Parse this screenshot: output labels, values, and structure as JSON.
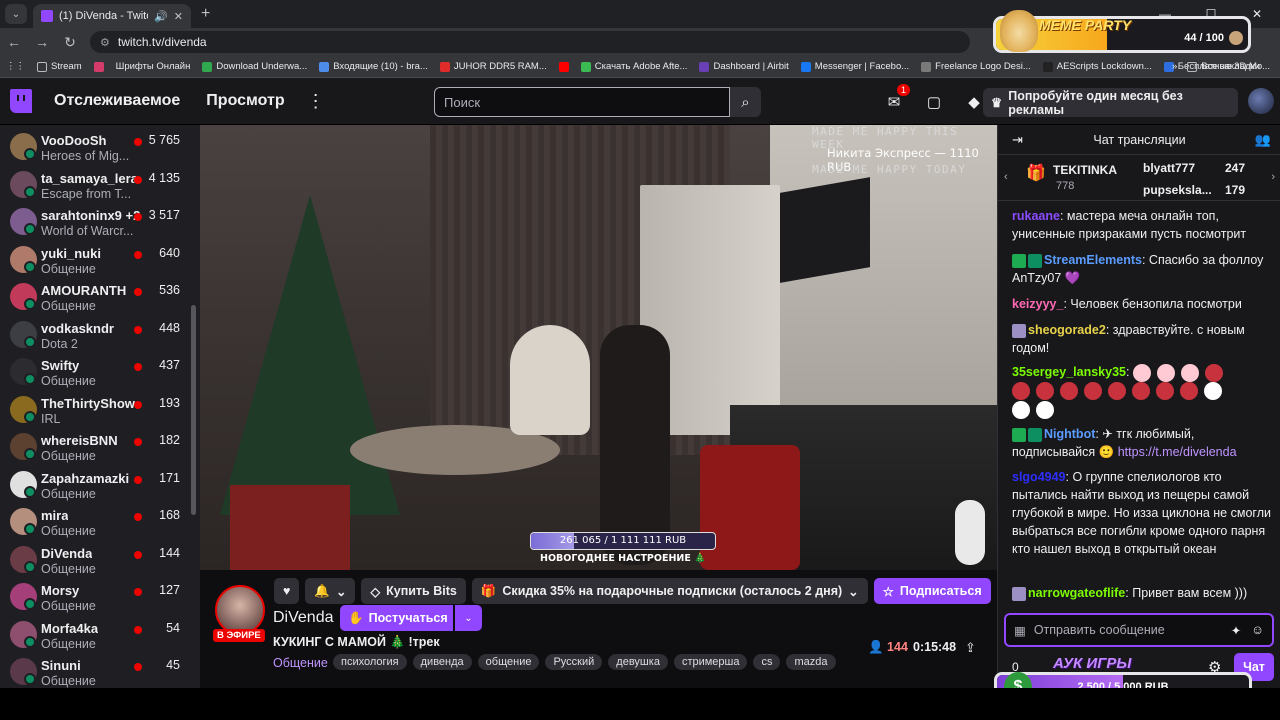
{
  "browser": {
    "tab_title": "(1) DiVenda - Twitch",
    "url": "twitch.tv/divenda",
    "bookmarks": [
      "Stream",
      "Шрифты Онлайн",
      "Download Underwa...",
      "Входящие (10) - bra...",
      "JUHOR DDR5 RAM...",
      "Скачать Adobe Afte...",
      "Dashboard | Airbit",
      "Messenger | Facebo...",
      "Freelance Logo Desi...",
      "AEScripts Lockdown...",
      "Бесплатные 3D Mo..."
    ],
    "all_bookmarks": "Все закладки"
  },
  "nav": {
    "following": "Отслеживаемое",
    "browse": "Просмотр",
    "search_placeholder": "Поиск",
    "inbox_badge": "1",
    "promo": "Попробуйте один месяц без рекламы"
  },
  "meme_party": {
    "title": "MEME PARTY",
    "count": "44 / 100",
    "progress": 0.44
  },
  "sidebar": [
    {
      "name": "VooDooSh",
      "category": "Heroes of Mig...",
      "viewers": "5 765",
      "color": "#8a6d4b"
    },
    {
      "name": "ta_samaya_lera",
      "category": "Escape from T...",
      "viewers": "4 135",
      "color": "#6b4a5e"
    },
    {
      "name": "sarahtoninx9 +2",
      "category": "World of Warcr...",
      "viewers": "3 517",
      "color": "#7d5c8f"
    },
    {
      "name": "yuki_nuki",
      "category": "Общение",
      "viewers": "640",
      "color": "#b07a6b"
    },
    {
      "name": "AMOURANTH",
      "category": "Общение",
      "viewers": "536",
      "color": "#c23a5a"
    },
    {
      "name": "vodkaskndr",
      "category": "Dota 2",
      "viewers": "448",
      "color": "#3d3d44"
    },
    {
      "name": "Swifty",
      "category": "Общение",
      "viewers": "437",
      "color": "#2c2c30"
    },
    {
      "name": "TheThirtyShow",
      "category": "IRL",
      "viewers": "193",
      "color": "#8a6a1e"
    },
    {
      "name": "whereisBNN",
      "category": "Общение",
      "viewers": "182",
      "color": "#5c4030"
    },
    {
      "name": "Zapahzamazki",
      "category": "Общение",
      "viewers": "171",
      "color": "#e0e0e0"
    },
    {
      "name": "mira",
      "category": "Общение",
      "viewers": "168",
      "color": "#b58f7e"
    },
    {
      "name": "DiVenda",
      "category": "Общение",
      "viewers": "144",
      "color": "#6a3c45"
    },
    {
      "name": "Morsy",
      "category": "Общение",
      "viewers": "127",
      "color": "#a43f7a"
    },
    {
      "name": "Morfa4ka",
      "category": "Общение",
      "viewers": "54",
      "color": "#8e4e6e"
    },
    {
      "name": "Sinuni",
      "category": "Общение",
      "viewers": "45",
      "color": "#5a3a4a"
    }
  ],
  "video_overlay": {
    "line1": "MADE ME HAPPY THIS WEEK",
    "line2": "Никита Экспресс — 1110 RUB",
    "line3": "MADE ME HAPPY TODAY",
    "goal_text": "261 065 / 1 111 111 RUB",
    "goal_name": "НОВОГОДНЕЕ НАСТРОЕНИЕ 🎄",
    "goal_progress": 0.235
  },
  "stream": {
    "live": "В ЭФИРЕ",
    "channel": "DiVenda",
    "follow": "Постучаться",
    "title": "КУКИНГ С МАМОЙ 🎄 !трек",
    "category": "Общение",
    "tags": [
      "психология",
      "дивенда",
      "общение",
      "Русский",
      "девушка",
      "стримерша",
      "cs",
      "mazda"
    ],
    "buy_bits": "Купить Bits",
    "discount": "Скидка 35% на подарочные подписки (осталось 2 дня)",
    "subscribe": "Подписаться",
    "viewers": "144",
    "uptime": "0:15:48"
  },
  "chat": {
    "title": "Чат трансляции",
    "leader1": {
      "name": "TEKITINKA",
      "bits": "778"
    },
    "leader2": {
      "name": "blyatt777",
      "count": "247"
    },
    "leader3": {
      "name": "pupseksla...",
      "count": "179"
    },
    "messages": [
      {
        "user": "rukaane",
        "color": "#8a4bff",
        "text": "мастера меча онлайн топ, унисенные призраками пусть посмотрит"
      },
      {
        "user": "StreamElements",
        "color": "#5b9cff",
        "text": "Спасибо за фоллоу AnTzy07 💜"
      },
      {
        "user": "keizyyy_",
        "color": "#ff69b4",
        "text": "Человек бензопила посмотри"
      },
      {
        "user": "sheogorade2",
        "color": "#e8d24a",
        "text": "здравствуйте. с новым годом!"
      },
      {
        "user": "35sergey_lansky35",
        "color": "#7cfc00",
        "text": ""
      },
      {
        "user": "Nightbot",
        "color": "#5b9cff",
        "text": "тгк любимый, подписывайся",
        "link": "https://t.me/divelenda"
      },
      {
        "user": "slgo4949",
        "color": "#2e2eff",
        "text": "О группе спелиологов кто пытались найти выход из пещеры самой глубокой в мире. Но изза циклона не смогли выбраться все погибли кроме одного парня кто нашел выход в открытый океан"
      },
      {
        "user": "narrowgateoflife",
        "color": "#7cfc00",
        "text": "Привет вам всем )))"
      }
    ],
    "input_placeholder": "Отправить сообщение",
    "bits_count": "0",
    "send": "Чат"
  },
  "auction": {
    "title": "АУК ИГРЫ",
    "amount": "2 500 / 5 000 RUB",
    "progress": 0.5
  }
}
